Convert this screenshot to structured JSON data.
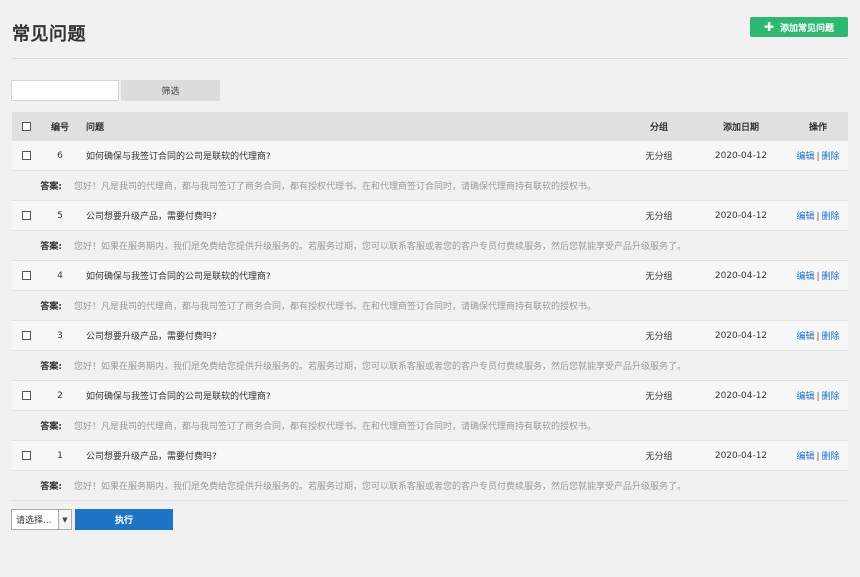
{
  "page": {
    "title": "常见问题"
  },
  "actions": {
    "add_label": "添加常见问题",
    "add_icon": "plus-icon"
  },
  "filter": {
    "input_value": "",
    "button_label": "筛选"
  },
  "table": {
    "headers": {
      "id": "编号",
      "question": "问题",
      "category": "分组",
      "date": "添加日期",
      "actions": "操作"
    },
    "answer_label": "答案:",
    "edit_label": "编辑",
    "delete_label": "删除",
    "separator": "|",
    "rows": [
      {
        "id": "6",
        "question": "如何确保与我签订合同的公司是联软的代理商?",
        "category": "无分组",
        "date": "2020-04-12",
        "answer": "您好！凡是我司的代理商，都与我司签订了商务合同，都有授权代理书。在和代理商签订合同时，请确保代理商持有联软的授权书。"
      },
      {
        "id": "5",
        "question": "公司想要升级产品，需要付费吗?",
        "category": "无分组",
        "date": "2020-04-12",
        "answer": "您好！如果在服务期内，我们是免费给您提供升级服务的。若服务过期，您可以联系客服或者您的客户专员付费续服务，然后您就能享受产品升级服务了。"
      },
      {
        "id": "4",
        "question": "如何确保与我签订合同的公司是联软的代理商?",
        "category": "无分组",
        "date": "2020-04-12",
        "answer": "您好！凡是我司的代理商，都与我司签订了商务合同，都有授权代理书。在和代理商签订合同时，请确保代理商持有联软的授权书。"
      },
      {
        "id": "3",
        "question": "公司想要升级产品，需要付费吗?",
        "category": "无分组",
        "date": "2020-04-12",
        "answer": "您好！如果在服务期内，我们是免费给您提供升级服务的。若服务过期，您可以联系客服或者您的客户专员付费续服务，然后您就能享受产品升级服务了。"
      },
      {
        "id": "2",
        "question": "如何确保与我签订合同的公司是联软的代理商?",
        "category": "无分组",
        "date": "2020-04-12",
        "answer": "您好！凡是我司的代理商，都与我司签订了商务合同，都有授权代理书。在和代理商签订合同时，请确保代理商持有联软的授权书。"
      },
      {
        "id": "1",
        "question": "公司想要升级产品，需要付费吗?",
        "category": "无分组",
        "date": "2020-04-12",
        "answer": "您好！如果在服务期内，我们是免费给您提供升级服务的。若服务过期，您可以联系客服或者您的客户专员付费续服务，然后您就能享受产品升级服务了。"
      }
    ]
  },
  "bulk": {
    "select_value": "请选择...",
    "execute_label": "执行"
  },
  "colors": {
    "add_button": "#2eb872",
    "execute_button": "#1e73c4",
    "link": "#1e6fc8"
  }
}
